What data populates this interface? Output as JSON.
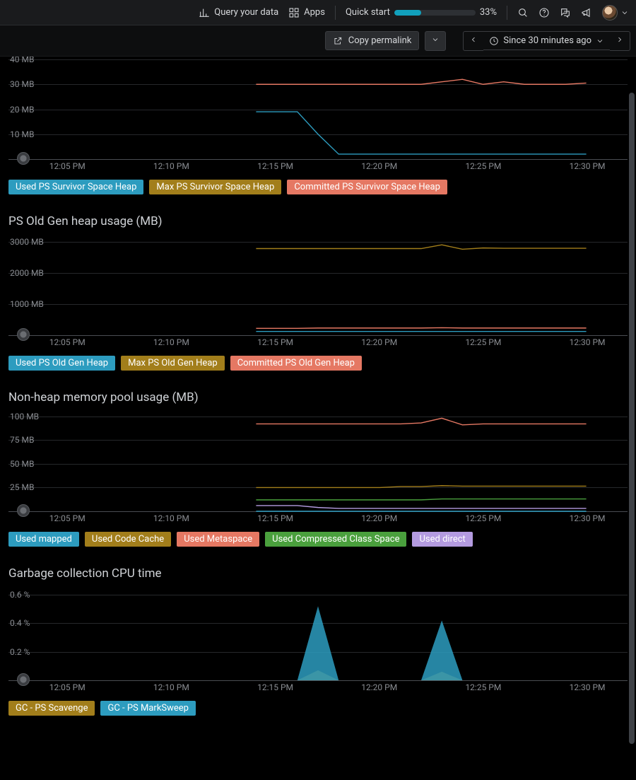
{
  "topbar": {
    "query_label": "Query your data",
    "apps_label": "Apps",
    "quickstart_label": "Quick start",
    "progress_pct": 33,
    "progress_text": "33%"
  },
  "subbar": {
    "permalink_label": "Copy permalink",
    "timerange_label": "Since 30 minutes ago"
  },
  "x_axis": {
    "ticks": [
      "12:05 PM",
      "12:10 PM",
      "12:15 PM",
      "12:20 PM",
      "12:25 PM",
      "12:30 PM"
    ],
    "positions_pct": [
      9.5,
      26.3,
      43.1,
      59.9,
      76.7,
      93.5
    ]
  },
  "colors": {
    "teal": "#2d9cbf",
    "olive": "#a27e1b",
    "coral": "#e57863",
    "green": "#4aa03d",
    "lilac": "#b49be0"
  },
  "chart_data": [
    {
      "id": "survivor",
      "type": "line",
      "title": "",
      "ylabel": "MB",
      "ylim": [
        0,
        40
      ],
      "yticks": [
        10,
        20,
        30,
        40
      ],
      "ytick_labels": [
        "10 MB",
        "20 MB",
        "30 MB",
        "40 MB"
      ],
      "x": [
        "12:15 PM",
        "12:16 PM",
        "12:17 PM",
        "12:18 PM",
        "12:19 PM",
        "12:20 PM",
        "12:21 PM",
        "12:22 PM",
        "12:23 PM",
        "12:24 PM",
        "12:25 PM",
        "12:26 PM",
        "12:27 PM",
        "12:28 PM",
        "12:29 PM",
        "12:30 PM",
        "12:31 PM"
      ],
      "series": [
        {
          "name": "Used PS Survivor Space Heap",
          "color": "teal",
          "values": [
            19,
            19,
            19,
            10,
            2,
            2,
            2,
            2,
            2,
            2,
            2,
            2,
            2,
            2,
            2,
            2,
            2
          ]
        },
        {
          "name": "Max PS Survivor Space Heap",
          "color": "olive",
          "values": [
            null,
            null,
            null,
            null,
            null,
            null,
            null,
            null,
            null,
            null,
            null,
            null,
            null,
            null,
            null,
            null,
            null
          ]
        },
        {
          "name": "Committed PS Survivor Space Heap",
          "color": "coral",
          "values": [
            30,
            30,
            30,
            30,
            30,
            30,
            30,
            30,
            30,
            31,
            32,
            30,
            31,
            30,
            30,
            30,
            30.5
          ]
        }
      ],
      "legend": [
        {
          "label": "Used PS Survivor Space Heap",
          "color": "teal"
        },
        {
          "label": "Max PS Survivor Space Heap",
          "color": "olive"
        },
        {
          "label": "Committed PS Survivor Space Heap",
          "color": "coral"
        }
      ]
    },
    {
      "id": "oldgen",
      "type": "line",
      "title": "PS Old Gen heap usage (MB)",
      "ylabel": "MB",
      "ylim": [
        0,
        3200
      ],
      "yticks": [
        1000,
        2000,
        3000
      ],
      "ytick_labels": [
        "1000 MB",
        "2000 MB",
        "3000 MB"
      ],
      "x": [
        "12:15 PM",
        "12:16 PM",
        "12:17 PM",
        "12:18 PM",
        "12:19 PM",
        "12:20 PM",
        "12:21 PM",
        "12:22 PM",
        "12:23 PM",
        "12:24 PM",
        "12:25 PM",
        "12:26 PM",
        "12:27 PM",
        "12:28 PM",
        "12:29 PM",
        "12:30 PM",
        "12:31 PM"
      ],
      "series": [
        {
          "name": "Used PS Old Gen Heap",
          "color": "teal",
          "values": [
            120,
            120,
            120,
            120,
            120,
            120,
            120,
            120,
            120,
            120,
            120,
            120,
            120,
            120,
            120,
            120,
            120
          ]
        },
        {
          "name": "Max PS Old Gen Heap",
          "color": "olive",
          "values": [
            2780,
            2780,
            2780,
            2780,
            2780,
            2780,
            2780,
            2780,
            2780,
            2900,
            2760,
            2800,
            2790,
            2790,
            2790,
            2790,
            2790
          ]
        },
        {
          "name": "Committed PS Old Gen Heap",
          "color": "coral",
          "values": [
            220,
            220,
            220,
            230,
            230,
            230,
            230,
            230,
            230,
            240,
            230,
            230,
            230,
            230,
            230,
            230,
            230
          ]
        }
      ],
      "legend": [
        {
          "label": "Used PS Old Gen Heap",
          "color": "teal"
        },
        {
          "label": "Max PS Old Gen Heap",
          "color": "olive"
        },
        {
          "label": "Committed PS Old Gen Heap",
          "color": "coral"
        }
      ]
    },
    {
      "id": "nonheap",
      "type": "line",
      "title": "Non-heap memory pool usage (MB)",
      "ylabel": "MB",
      "ylim": [
        0,
        105
      ],
      "yticks": [
        25,
        50,
        75,
        100
      ],
      "ytick_labels": [
        "25 MB",
        "50 MB",
        "75 MB",
        "100 MB"
      ],
      "x": [
        "12:15 PM",
        "12:16 PM",
        "12:17 PM",
        "12:18 PM",
        "12:19 PM",
        "12:20 PM",
        "12:21 PM",
        "12:22 PM",
        "12:23 PM",
        "12:24 PM",
        "12:25 PM",
        "12:26 PM",
        "12:27 PM",
        "12:28 PM",
        "12:29 PM",
        "12:30 PM",
        "12:31 PM"
      ],
      "series": [
        {
          "name": "Used mapped",
          "color": "teal",
          "values": [
            0,
            0,
            0,
            0,
            0,
            0,
            0,
            0,
            0,
            0,
            0,
            0,
            0,
            0,
            0,
            0,
            0
          ]
        },
        {
          "name": "Used Code Cache",
          "color": "olive",
          "values": [
            25,
            25,
            25,
            25,
            25,
            25,
            25,
            26,
            26,
            27,
            26.5,
            26.5,
            26.5,
            26.5,
            26.5,
            26.5,
            26.5
          ]
        },
        {
          "name": "Used Metaspace",
          "color": "coral",
          "values": [
            92,
            92,
            92,
            92,
            92,
            92,
            92,
            92,
            93,
            98,
            91,
            92,
            92,
            92,
            92,
            92,
            92
          ]
        },
        {
          "name": "Used Compressed Class Space",
          "color": "green",
          "values": [
            12,
            12,
            12,
            12,
            12,
            12,
            12,
            12,
            12,
            13,
            13,
            13,
            13,
            13,
            13,
            13,
            13
          ]
        },
        {
          "name": "Used direct",
          "color": "lilac",
          "values": [
            6,
            6,
            6,
            4,
            3,
            3,
            3,
            3,
            3,
            3,
            3,
            3,
            3,
            3,
            3,
            3,
            3
          ]
        }
      ],
      "legend": [
        {
          "label": "Used mapped",
          "color": "teal"
        },
        {
          "label": "Used Code Cache",
          "color": "olive"
        },
        {
          "label": "Used Metaspace",
          "color": "coral"
        },
        {
          "label": "Used Compressed Class Space",
          "color": "green"
        },
        {
          "label": "Used direct",
          "color": "lilac"
        }
      ]
    },
    {
      "id": "gc",
      "type": "area",
      "title": "Garbage collection CPU time",
      "ylabel": "%",
      "ylim": [
        0,
        0.65
      ],
      "yticks": [
        0.2,
        0.4,
        0.6
      ],
      "ytick_labels": [
        "0.2 %",
        "0.4 %",
        "0.6 %"
      ],
      "x": [
        "12:15 PM",
        "12:16 PM",
        "12:17 PM",
        "12:18 PM",
        "12:19 PM",
        "12:20 PM",
        "12:21 PM",
        "12:22 PM",
        "12:23 PM",
        "12:24 PM",
        "12:25 PM",
        "12:26 PM",
        "12:27 PM",
        "12:28 PM",
        "12:29 PM",
        "12:30 PM",
        "12:31 PM"
      ],
      "series": [
        {
          "name": "GC - PS Scavenge",
          "color": "olive",
          "values": [
            0,
            0,
            0,
            0.07,
            0,
            0,
            0,
            0,
            0,
            0.06,
            0,
            0,
            0,
            0,
            0,
            0,
            0
          ]
        },
        {
          "name": "GC - PS MarkSweep",
          "color": "teal",
          "values": [
            0,
            0,
            0,
            0.52,
            0,
            0,
            0,
            0,
            0,
            0.42,
            0,
            0,
            0,
            0,
            0,
            0,
            0
          ]
        }
      ],
      "legend": [
        {
          "label": "GC - PS Scavenge",
          "color": "olive"
        },
        {
          "label": "GC - PS MarkSweep",
          "color": "teal"
        }
      ]
    }
  ]
}
